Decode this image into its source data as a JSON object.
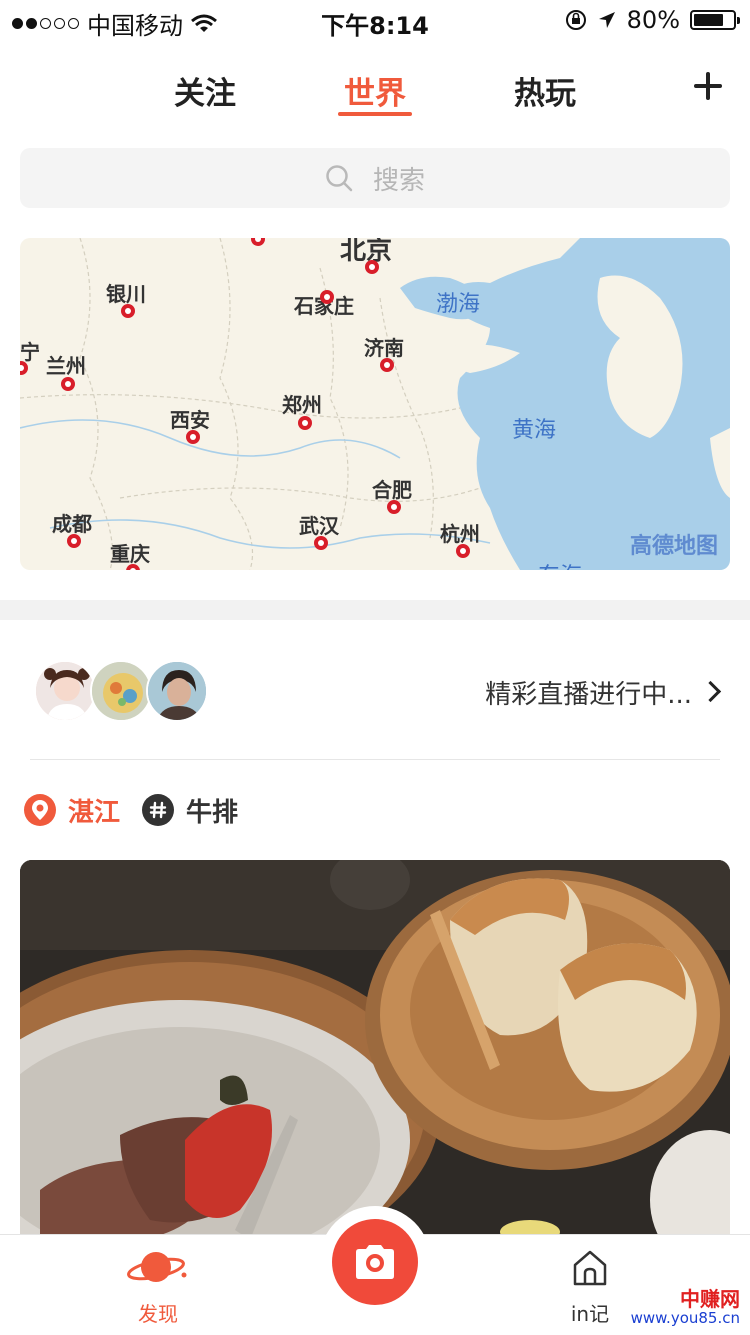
{
  "status_bar": {
    "carrier": "中国移动",
    "time": "下午8:14",
    "battery": "80%",
    "battery_level": 0.8
  },
  "nav": {
    "tabs": [
      {
        "label": "关注",
        "active": false
      },
      {
        "label": "世界",
        "active": true
      },
      {
        "label": "热玩",
        "active": false
      }
    ],
    "add_icon": "plus-icon"
  },
  "search": {
    "placeholder": "搜索",
    "icon": "search-icon"
  },
  "map": {
    "cities": [
      "北京",
      "银川",
      "石家庄",
      "宁",
      "兰州",
      "济南",
      "西安",
      "郑州",
      "合肥",
      "成都",
      "武汉",
      "重庆",
      "杭州"
    ],
    "seas": [
      "渤海",
      "黄海",
      "东海"
    ],
    "attribution": "高德地图"
  },
  "live": {
    "text": "精彩直播进行中...",
    "avatar_count": 3
  },
  "tags": [
    {
      "icon": "location-pin-icon",
      "label": "湛江",
      "color": "#f05a3c"
    },
    {
      "icon": "hashtag-icon",
      "label": "牛排",
      "color": "#333333"
    }
  ],
  "tabbar": {
    "discover": "发现",
    "camera_icon": "camera-icon",
    "in_note": "in记"
  },
  "watermark": {
    "title": "中赚网",
    "url": "www.you85.cn"
  },
  "colors": {
    "accent": "#f05a3c",
    "camera": "#f04a3a"
  }
}
